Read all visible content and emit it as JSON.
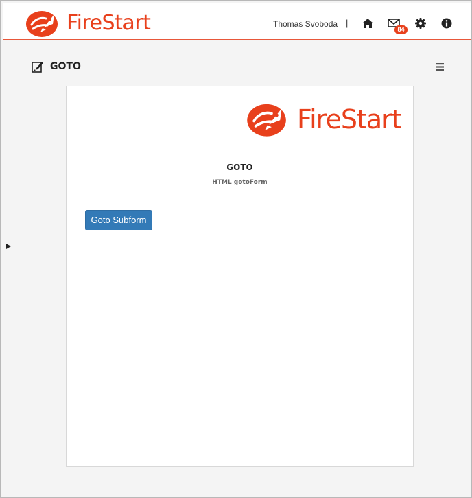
{
  "header": {
    "logo_text": "FireStart",
    "user_name": "Thomas Svoboda",
    "separator": "|",
    "mail_badge": "84",
    "icons": [
      "home-icon",
      "mail-icon",
      "gear-icon",
      "info-icon"
    ]
  },
  "page": {
    "title": "GOTO",
    "title_icon": "edit-form-icon",
    "menu_icon": "hamburger-menu-icon"
  },
  "form": {
    "logo_text": "FireStart",
    "title": "GOTO",
    "subtitle": "HTML gotoForm",
    "button_label": "Goto Subform"
  },
  "colors": {
    "brand": "#e8401c",
    "primary_button": "#337ab7",
    "background": "#f4f4f4"
  }
}
